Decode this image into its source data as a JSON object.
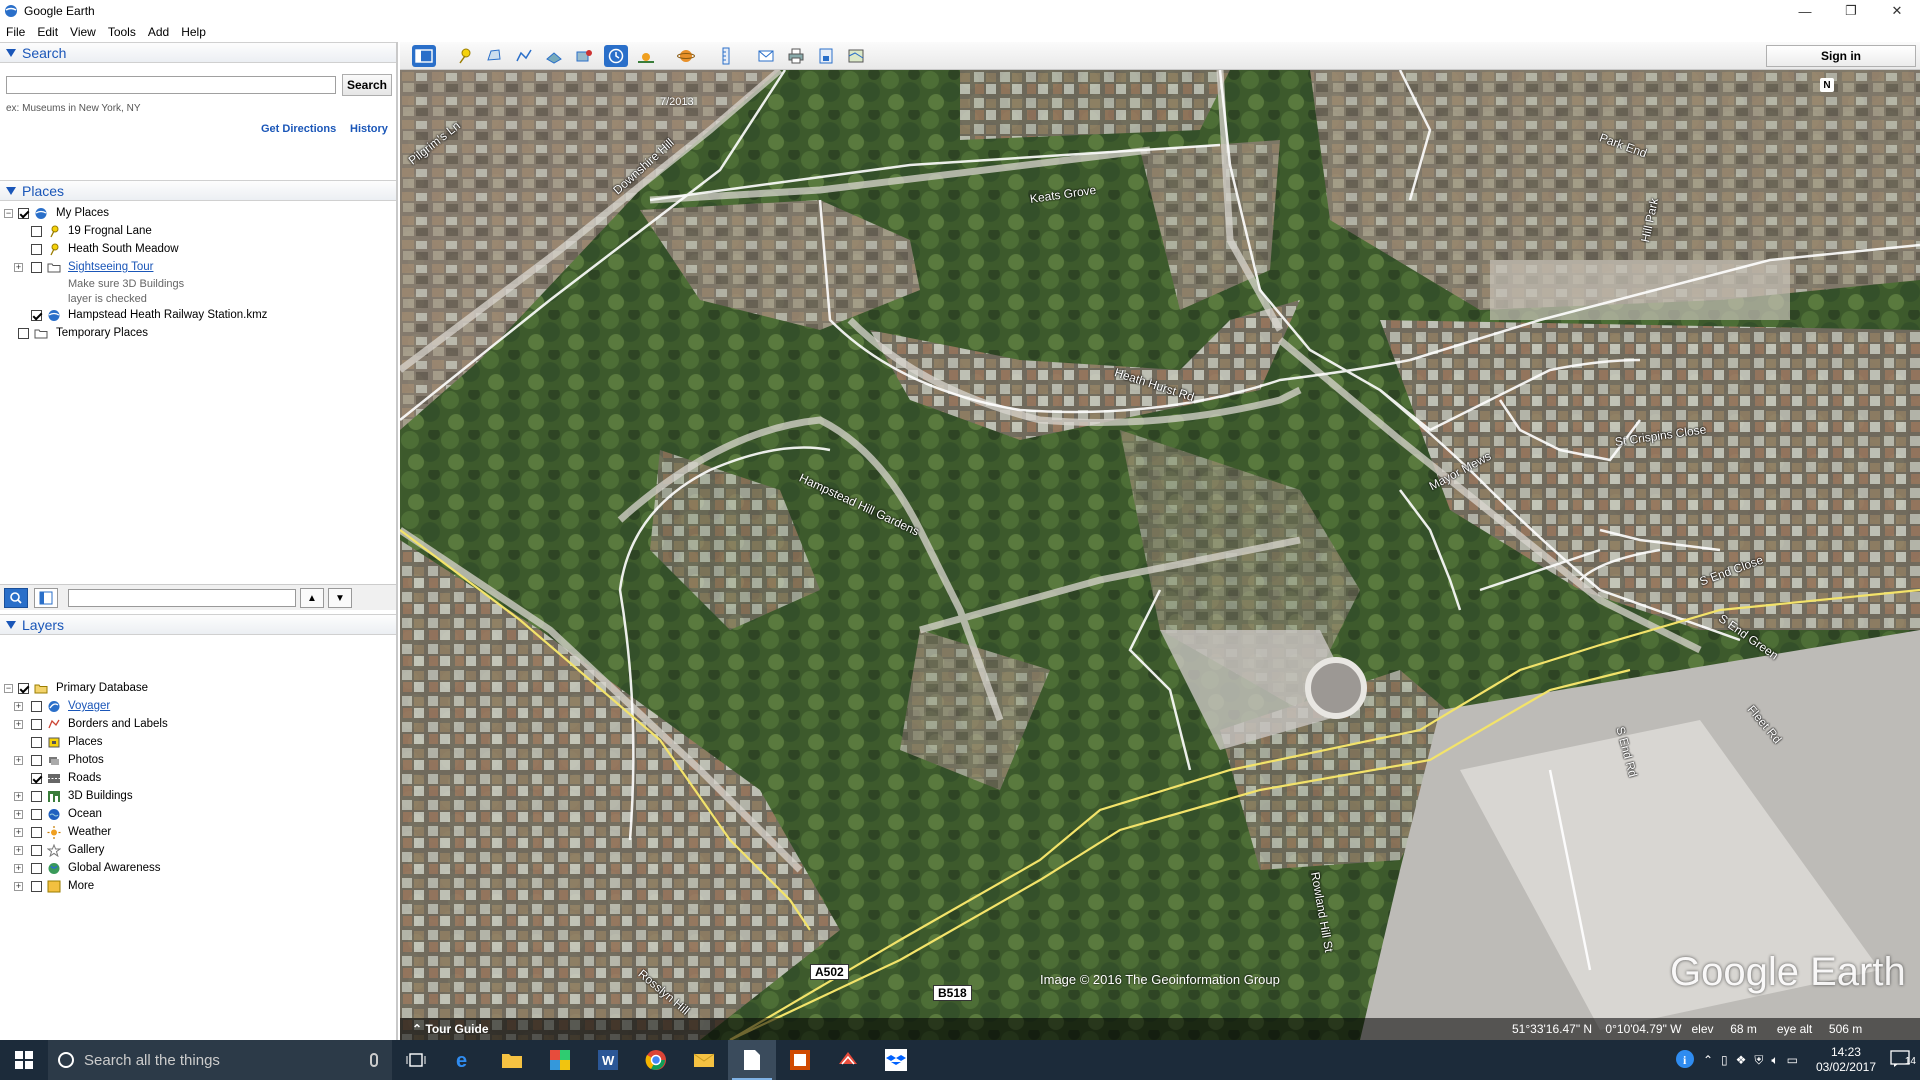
{
  "window": {
    "title": "Google Earth",
    "controls": [
      "—",
      "❐",
      "✕"
    ]
  },
  "menu": [
    "File",
    "Edit",
    "View",
    "Tools",
    "Add",
    "Help"
  ],
  "search": {
    "header": "Search",
    "value": "",
    "button": "Search",
    "hint": "ex: Museums in New York, NY",
    "get_directions": "Get Directions",
    "history": "History"
  },
  "places": {
    "header": "Places",
    "items": [
      {
        "label": "My Places",
        "checked": true,
        "expanded": true
      },
      {
        "label": "19 Frognal Lane",
        "checked": false
      },
      {
        "label": "Heath South Meadow",
        "checked": false
      },
      {
        "label": "Sightseeing Tour",
        "checked": false,
        "link": true
      },
      {
        "label": "Make sure 3D Buildings"
      },
      {
        "label": "layer is checked"
      },
      {
        "label": "Hampstead Heath Railway Station.kmz",
        "checked": true
      },
      {
        "label": "Temporary Places",
        "checked": false
      }
    ]
  },
  "layers": {
    "header": "Layers",
    "items": [
      {
        "label": "Primary Database",
        "checked": true
      },
      {
        "label": "Voyager",
        "checked": false,
        "link": true
      },
      {
        "label": "Borders and Labels",
        "checked": false
      },
      {
        "label": "Places",
        "checked": false
      },
      {
        "label": "Photos",
        "checked": false
      },
      {
        "label": "Roads",
        "checked": true
      },
      {
        "label": "3D Buildings",
        "checked": false
      },
      {
        "label": "Ocean",
        "checked": false
      },
      {
        "label": "Weather",
        "checked": false
      },
      {
        "label": "Gallery",
        "checked": false
      },
      {
        "label": "Global Awareness",
        "checked": false
      },
      {
        "label": "More",
        "checked": false
      }
    ]
  },
  "toolbar": {
    "sign_in": "Sign in"
  },
  "map": {
    "date": "7/2013",
    "north": "N",
    "road_labels": [
      "Pilgrim's Ln",
      "Downshire Hill",
      "Keats Grove",
      "Park End",
      "Hill Park",
      "Heath Hurst Rd",
      "Hampstead Hill Gardens",
      "St Crispins Close",
      "Mayor Mews",
      "S End Close",
      "S End Green",
      "S End Rd",
      "Fleet Rd",
      "Rowland Hill St",
      "Rosslyn Hill"
    ],
    "shields": [
      "A502",
      "B518"
    ],
    "attribution": "Image © 2016 The Geoinformation Group",
    "logo": "Google Earth",
    "tour_guide": "Tour Guide",
    "status": {
      "lat": "51°33'16.47\" N",
      "lon": "0°10'04.79\" W",
      "elev_label": "elev",
      "elev": "68 m",
      "eye_label": "eye alt",
      "eye": "506 m"
    }
  },
  "taskbar": {
    "search_placeholder": "Search all the things",
    "time": "14:23",
    "date": "03/02/2017",
    "notifications": "14"
  }
}
